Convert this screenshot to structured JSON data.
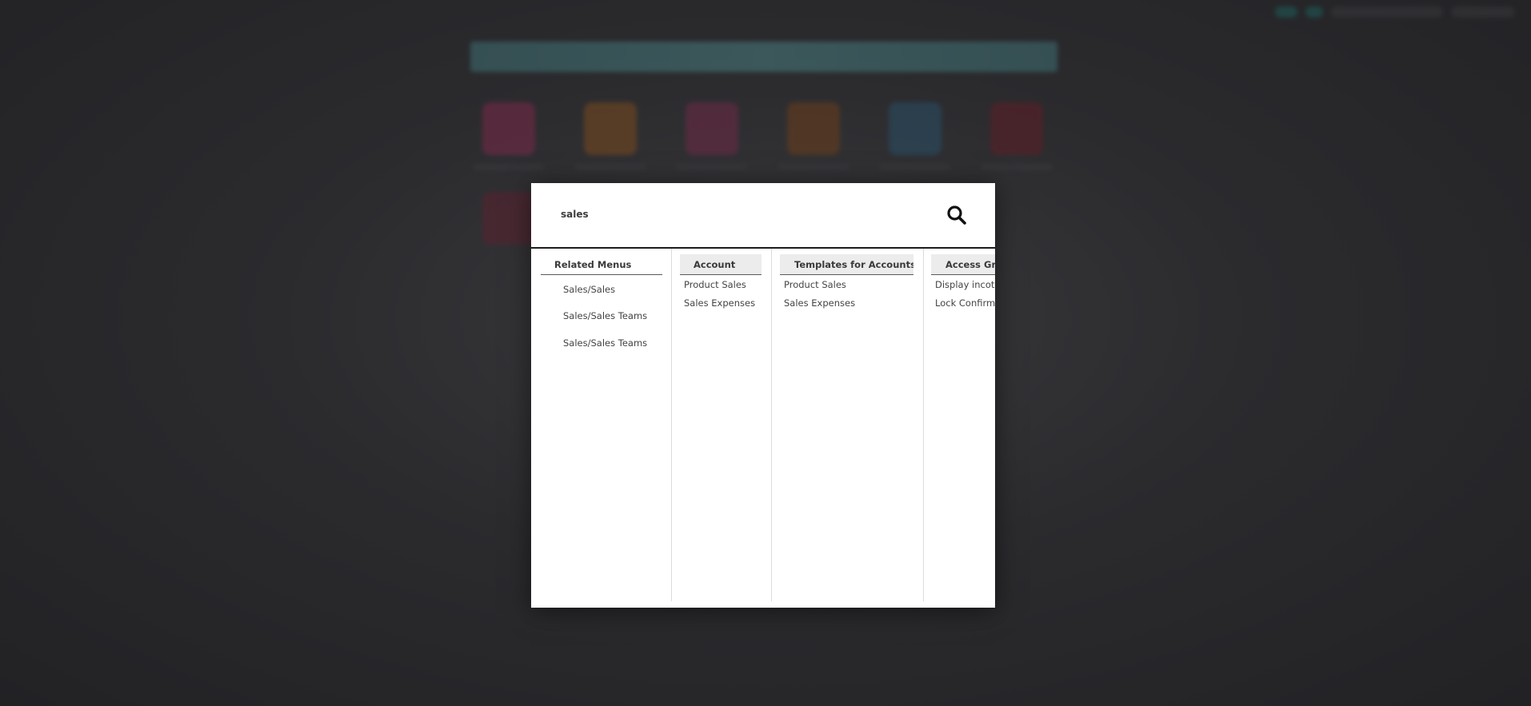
{
  "search": {
    "value": "sales"
  },
  "columns": {
    "related_menus": {
      "title": "Related Menus",
      "items": [
        "Sales/Sales",
        "Sales/Sales Teams",
        "Sales/Sales Teams"
      ]
    },
    "account": {
      "title": "Account",
      "items": [
        "Product Sales",
        "Sales Expenses"
      ]
    },
    "templates": {
      "title": "Templates for Accounts",
      "items": [
        "Product Sales",
        "Sales Expenses"
      ]
    },
    "access_groups": {
      "title": "Access Gro",
      "items": [
        "Display incote",
        "Lock Confirme"
      ]
    }
  },
  "colors": {
    "modal_background": "#ffffff",
    "overlay": "#2b2b2e",
    "header_shade": "#ececec",
    "search_icon": "#111111"
  },
  "icons": {
    "search": "search-icon"
  }
}
